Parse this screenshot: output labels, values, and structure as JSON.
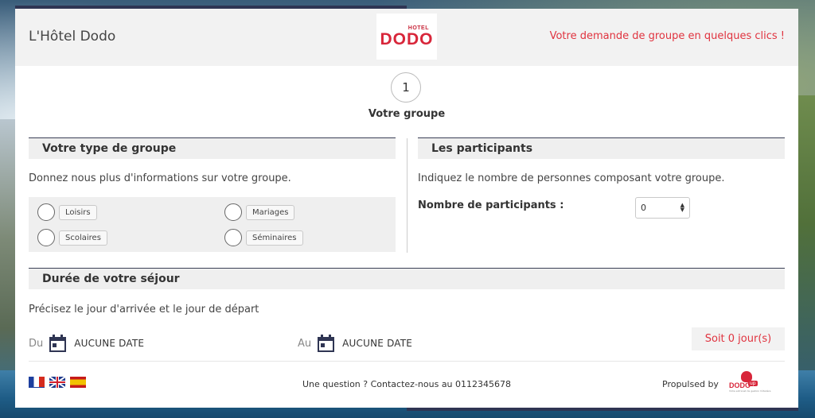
{
  "header": {
    "hotel_name": "L'Hôtel Dodo",
    "logo_small": "HOTEL",
    "logo_big": "DODO",
    "tagline": "Votre demande de groupe en quelques clics !"
  },
  "step": {
    "number": "1",
    "label": "Votre groupe"
  },
  "group_type": {
    "title": "Votre type de groupe",
    "description": "Donnez nous plus d'informations sur votre groupe.",
    "options": [
      "Loisirs",
      "Mariages",
      "Scolaires",
      "Séminaires"
    ]
  },
  "participants": {
    "title": "Les participants",
    "description": "Indiquez le nombre de personnes composant votre groupe.",
    "count_label": "Nombre de participants :",
    "count_value": "0"
  },
  "stay": {
    "title": "Durée de votre séjour",
    "description": "Précisez le jour d'arrivée et le jour de départ",
    "from_prefix": "Du",
    "from_value": "AUCUNE DATE",
    "to_prefix": "Au",
    "to_value": "AUCUNE DATE",
    "days_label": "Soit 0 jour(s)"
  },
  "footer": {
    "contact": "Une question ? Contactez-nous au 0112345678",
    "propulsed": "Propulsed by",
    "brand_text": "DODO",
    "brand_tag": "up",
    "brand_sub": "Votre extranet de gestion hôtelière"
  },
  "icons": {
    "calendar": "calendar-icon",
    "flags": [
      "flag-fr-icon",
      "flag-uk-icon",
      "flag-es-icon"
    ]
  },
  "colors": {
    "accent_red": "#e0333f",
    "navy": "#2f3553",
    "header_bg": "#f2f2f2"
  }
}
